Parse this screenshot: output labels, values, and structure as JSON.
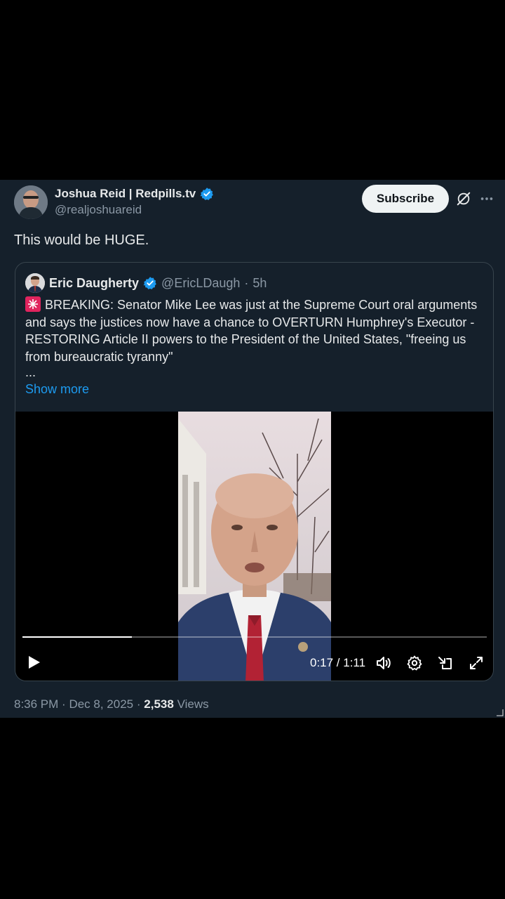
{
  "author": {
    "name": "Joshua Reid | Redpills.tv",
    "handle": "@realjoshuareid",
    "verified_color": "#1d9bf0"
  },
  "actions": {
    "subscribe_label": "Subscribe",
    "grok_icon": "grok-icon",
    "more_icon": "more-icon"
  },
  "post": {
    "text": "This would be HUGE."
  },
  "quoted_post": {
    "name": "Eric Daugherty",
    "handle": "@EricLDaugh",
    "separator": "·",
    "time": "5h",
    "siren_icon": "siren-icon",
    "body": "BREAKING: Senator Mike Lee was just at the Supreme Court oral arguments and says the justices now have a chance to OVERTURN Humphrey's Executor - RESTORING Article II powers to the President of the United States, \"freeing us from bureaucratic tyranny\"",
    "ellipsis": "...",
    "show_more": "Show more"
  },
  "video": {
    "time_display": "0:17 / 1:11",
    "progress": 0.235,
    "controls": [
      "play-icon",
      "volume-icon",
      "settings-icon",
      "minimize-icon",
      "fullscreen-icon"
    ]
  },
  "meta": {
    "time": "8:36 PM",
    "dot": "·",
    "date": "Dec 8, 2025",
    "views_count": "2,538",
    "views_label": "Views"
  },
  "colors": {
    "background": "#15202b",
    "accent": "#1d9bf0",
    "secondary_text": "#8b98a5"
  }
}
